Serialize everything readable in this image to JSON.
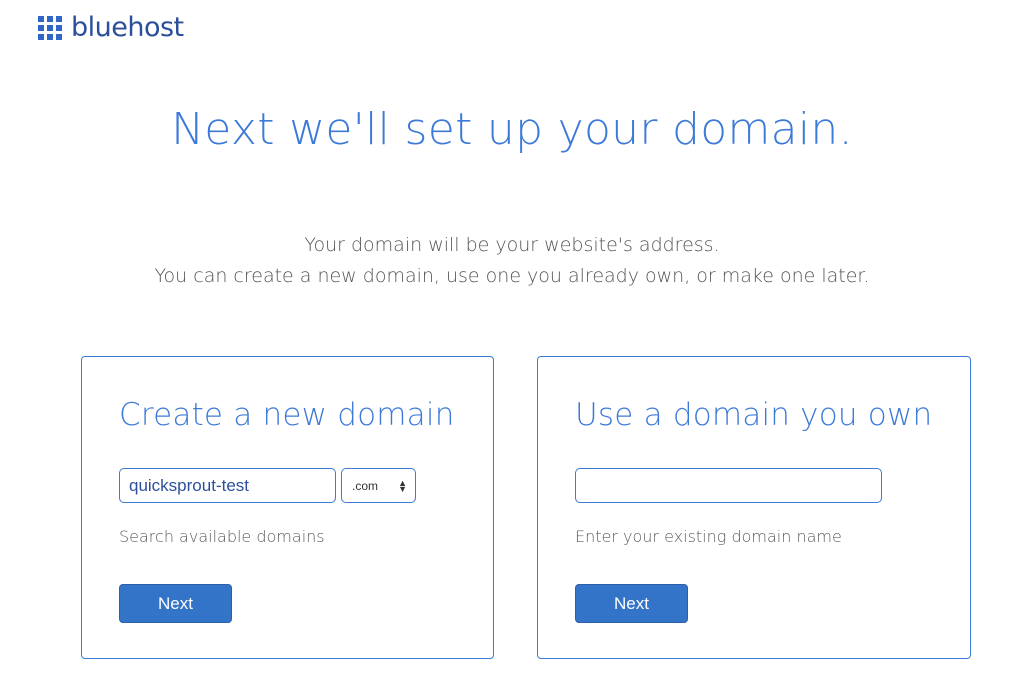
{
  "brand": {
    "name": "bluehost",
    "color": "#2f66c8"
  },
  "headline": "Next we'll set up your domain.",
  "subtitle": {
    "line1": "Your domain will be your website's address.",
    "line2": "You can create a new domain, use one you already own, or make one later."
  },
  "new_domain": {
    "title": "Create a new domain",
    "input_value": "quicksprout-test",
    "tld_selected": ".com",
    "helper": "Search available domains",
    "button": "Next"
  },
  "own_domain": {
    "title": "Use a domain you own",
    "input_value": "",
    "helper": "Enter your existing domain name",
    "button": "Next"
  },
  "colors": {
    "accent": "#3d7ad8",
    "button": "#3474c8"
  }
}
